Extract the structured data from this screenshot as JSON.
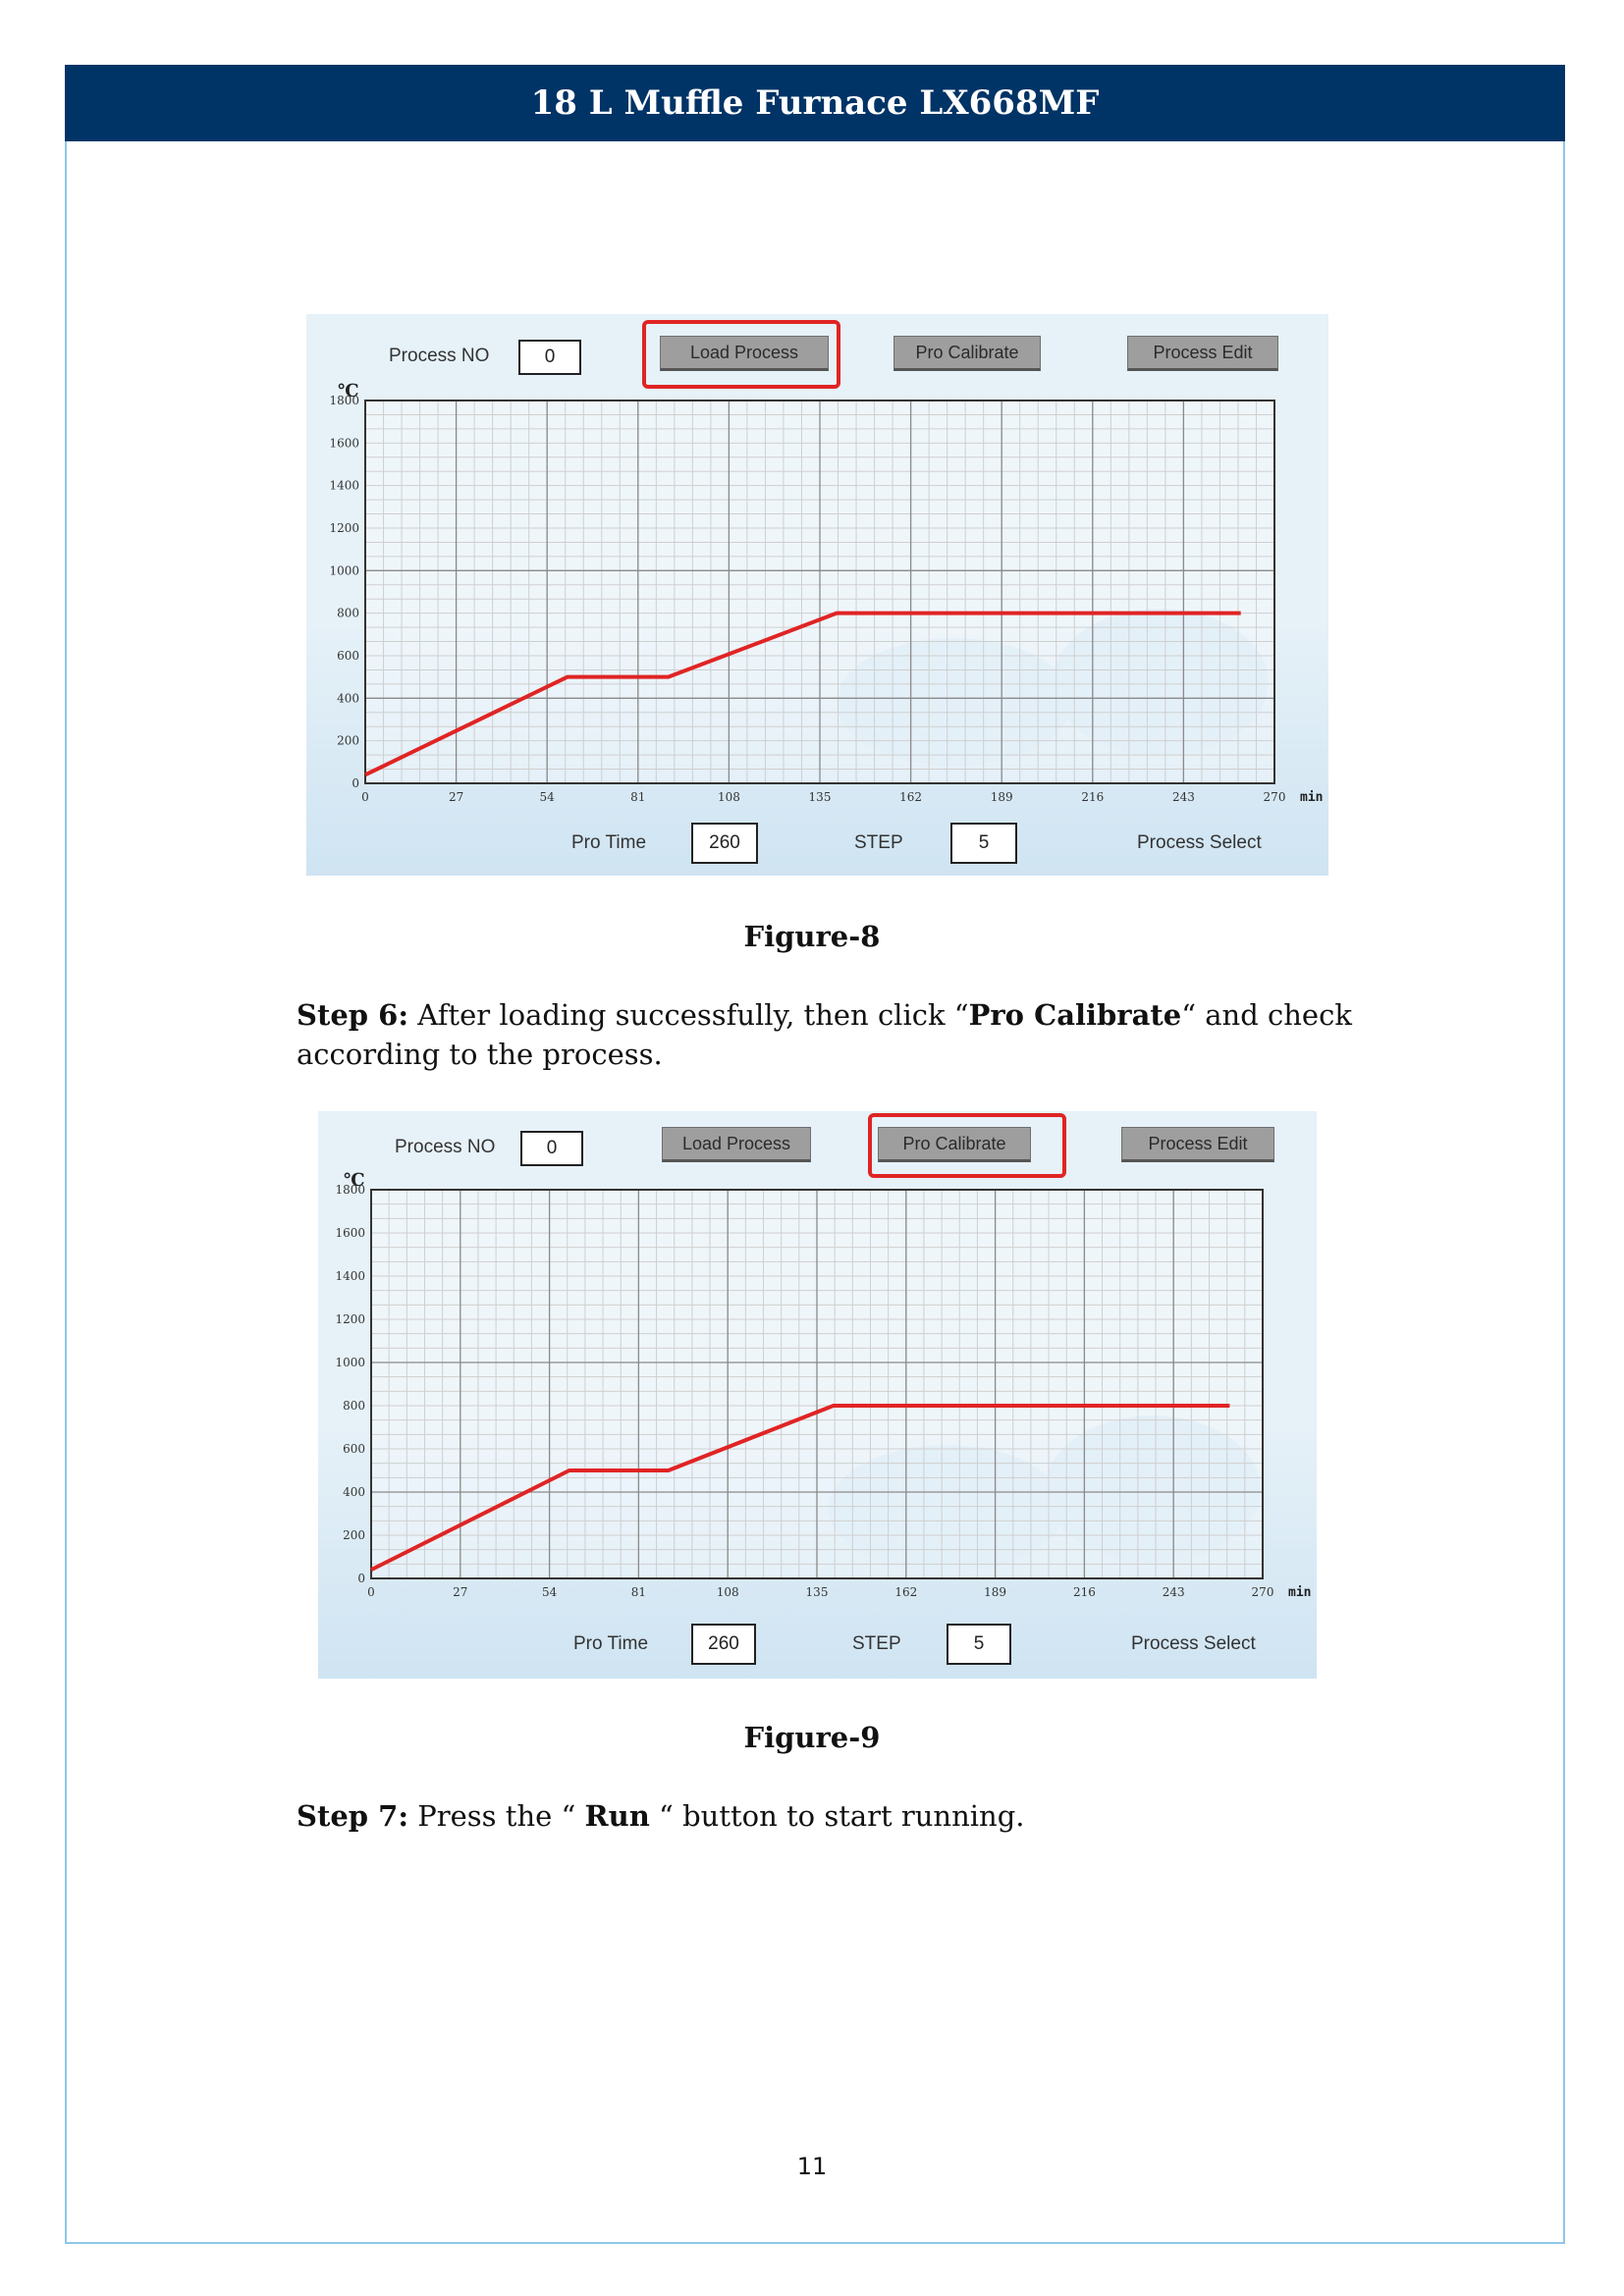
{
  "header": {
    "title": "18 L Muffle Furnace LX668MF"
  },
  "figure8": {
    "caption": "Figure-8",
    "process_no_label": "Process NO",
    "process_no_value": "0",
    "load_process": "Load Process",
    "pro_calibrate": "Pro Calibrate",
    "process_edit": "Process Edit",
    "y_unit": "℃",
    "x_unit": "min",
    "pro_time_label": "Pro Time",
    "pro_time_value": "260",
    "step_label": "STEP",
    "step_value": "5",
    "process_select": "Process Select",
    "highlighted_button": "Load Process"
  },
  "step6": {
    "prefix": "Step 6:",
    "text_before": " After loading successfully, then click “",
    "bold": "Pro Calibrate",
    "text_after": "“ and check according to the process."
  },
  "figure9": {
    "caption": "Figure-9",
    "process_no_label": "Process NO",
    "process_no_value": "0",
    "load_process": "Load Process",
    "pro_calibrate": "Pro Calibrate",
    "process_edit": "Process Edit",
    "y_unit": "℃",
    "x_unit": "min",
    "pro_time_label": "Pro Time",
    "pro_time_value": "260",
    "step_label": "STEP",
    "step_value": "5",
    "process_select": "Process Select",
    "highlighted_button": "Pro Calibrate"
  },
  "step7": {
    "prefix": "Step 7:",
    "text_before": " Press the “ ",
    "bold": "Run",
    "text_after": " “ button to start running."
  },
  "page_number": "11",
  "colors": {
    "header": "#003366",
    "frame": "#8fc6e6",
    "curve": "#e02424",
    "highlight": "#e02424"
  },
  "chart_data": [
    {
      "type": "line",
      "title": "",
      "xlabel": "min",
      "ylabel": "℃",
      "x_ticks": [
        0,
        27,
        54,
        81,
        108,
        135,
        162,
        189,
        216,
        243,
        270
      ],
      "y_ticks": [
        0,
        200,
        400,
        600,
        800,
        1000,
        1200,
        1400,
        1600,
        1800
      ],
      "xlim": [
        0,
        270
      ],
      "ylim": [
        0,
        1800
      ],
      "grid": true,
      "series": [
        {
          "x": [
            0,
            60,
            90,
            140,
            260
          ],
          "y": [
            40,
            500,
            500,
            800,
            800
          ]
        }
      ]
    },
    {
      "type": "line",
      "title": "",
      "xlabel": "min",
      "ylabel": "℃",
      "x_ticks": [
        0,
        27,
        54,
        81,
        108,
        135,
        162,
        189,
        216,
        243,
        270
      ],
      "y_ticks": [
        0,
        200,
        400,
        600,
        800,
        1000,
        1200,
        1400,
        1600,
        1800
      ],
      "xlim": [
        0,
        270
      ],
      "ylim": [
        0,
        1800
      ],
      "grid": true,
      "series": [
        {
          "x": [
            0,
            60,
            90,
            140,
            260
          ],
          "y": [
            40,
            500,
            500,
            800,
            800
          ]
        }
      ]
    }
  ]
}
